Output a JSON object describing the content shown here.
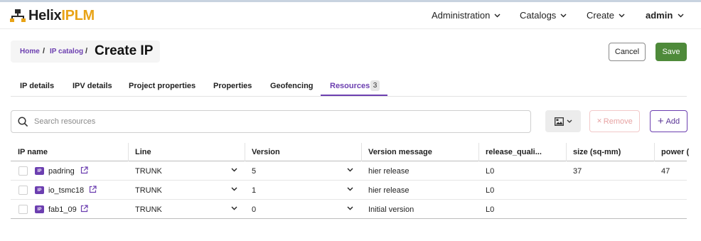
{
  "app": {
    "logo_main": "Helix",
    "logo_accent": "IPLM"
  },
  "nav": {
    "administration": "Administration",
    "catalogs": "Catalogs",
    "create": "Create",
    "user": "admin"
  },
  "breadcrumb": {
    "home": "Home",
    "sep1": "/",
    "ip_catalog": "IP catalog",
    "sep2": "/",
    "title": "Create IP"
  },
  "actions": {
    "cancel": "Cancel",
    "save": "Save"
  },
  "tabs": [
    {
      "label": "IP details"
    },
    {
      "label": "IPV details"
    },
    {
      "label": "Project properties"
    },
    {
      "label": "Properties"
    },
    {
      "label": "Geofencing"
    },
    {
      "label": "Resources",
      "badge": "3",
      "active": true
    }
  ],
  "toolbar": {
    "search_placeholder": "Search resources",
    "remove_label": "Remove",
    "remove_symbol": "✕",
    "add_label": "Add",
    "add_symbol": "+"
  },
  "table": {
    "headers": [
      "IP name",
      "Line",
      "Version",
      "Version message",
      "release_quali...",
      "size (sq-mm)",
      "power ("
    ],
    "rows": [
      {
        "ip_tag": "IP",
        "name": "padring",
        "line": "TRUNK",
        "version": "5",
        "message": "hier release",
        "release": "L0",
        "size": "37",
        "power": "47"
      },
      {
        "ip_tag": "IP",
        "name": "io_tsmc18",
        "line": "TRUNK",
        "version": "1",
        "message": "hier release",
        "release": "L0",
        "size": "",
        "power": ""
      },
      {
        "ip_tag": "IP",
        "name": "fab1_09",
        "line": "TRUNK",
        "version": "0",
        "message": "Initial version",
        "release": "L0",
        "size": "",
        "power": ""
      }
    ]
  },
  "colors": {
    "accent": "#6c3fb0",
    "save": "#4e8a3a",
    "logo_accent": "#e8a317"
  }
}
